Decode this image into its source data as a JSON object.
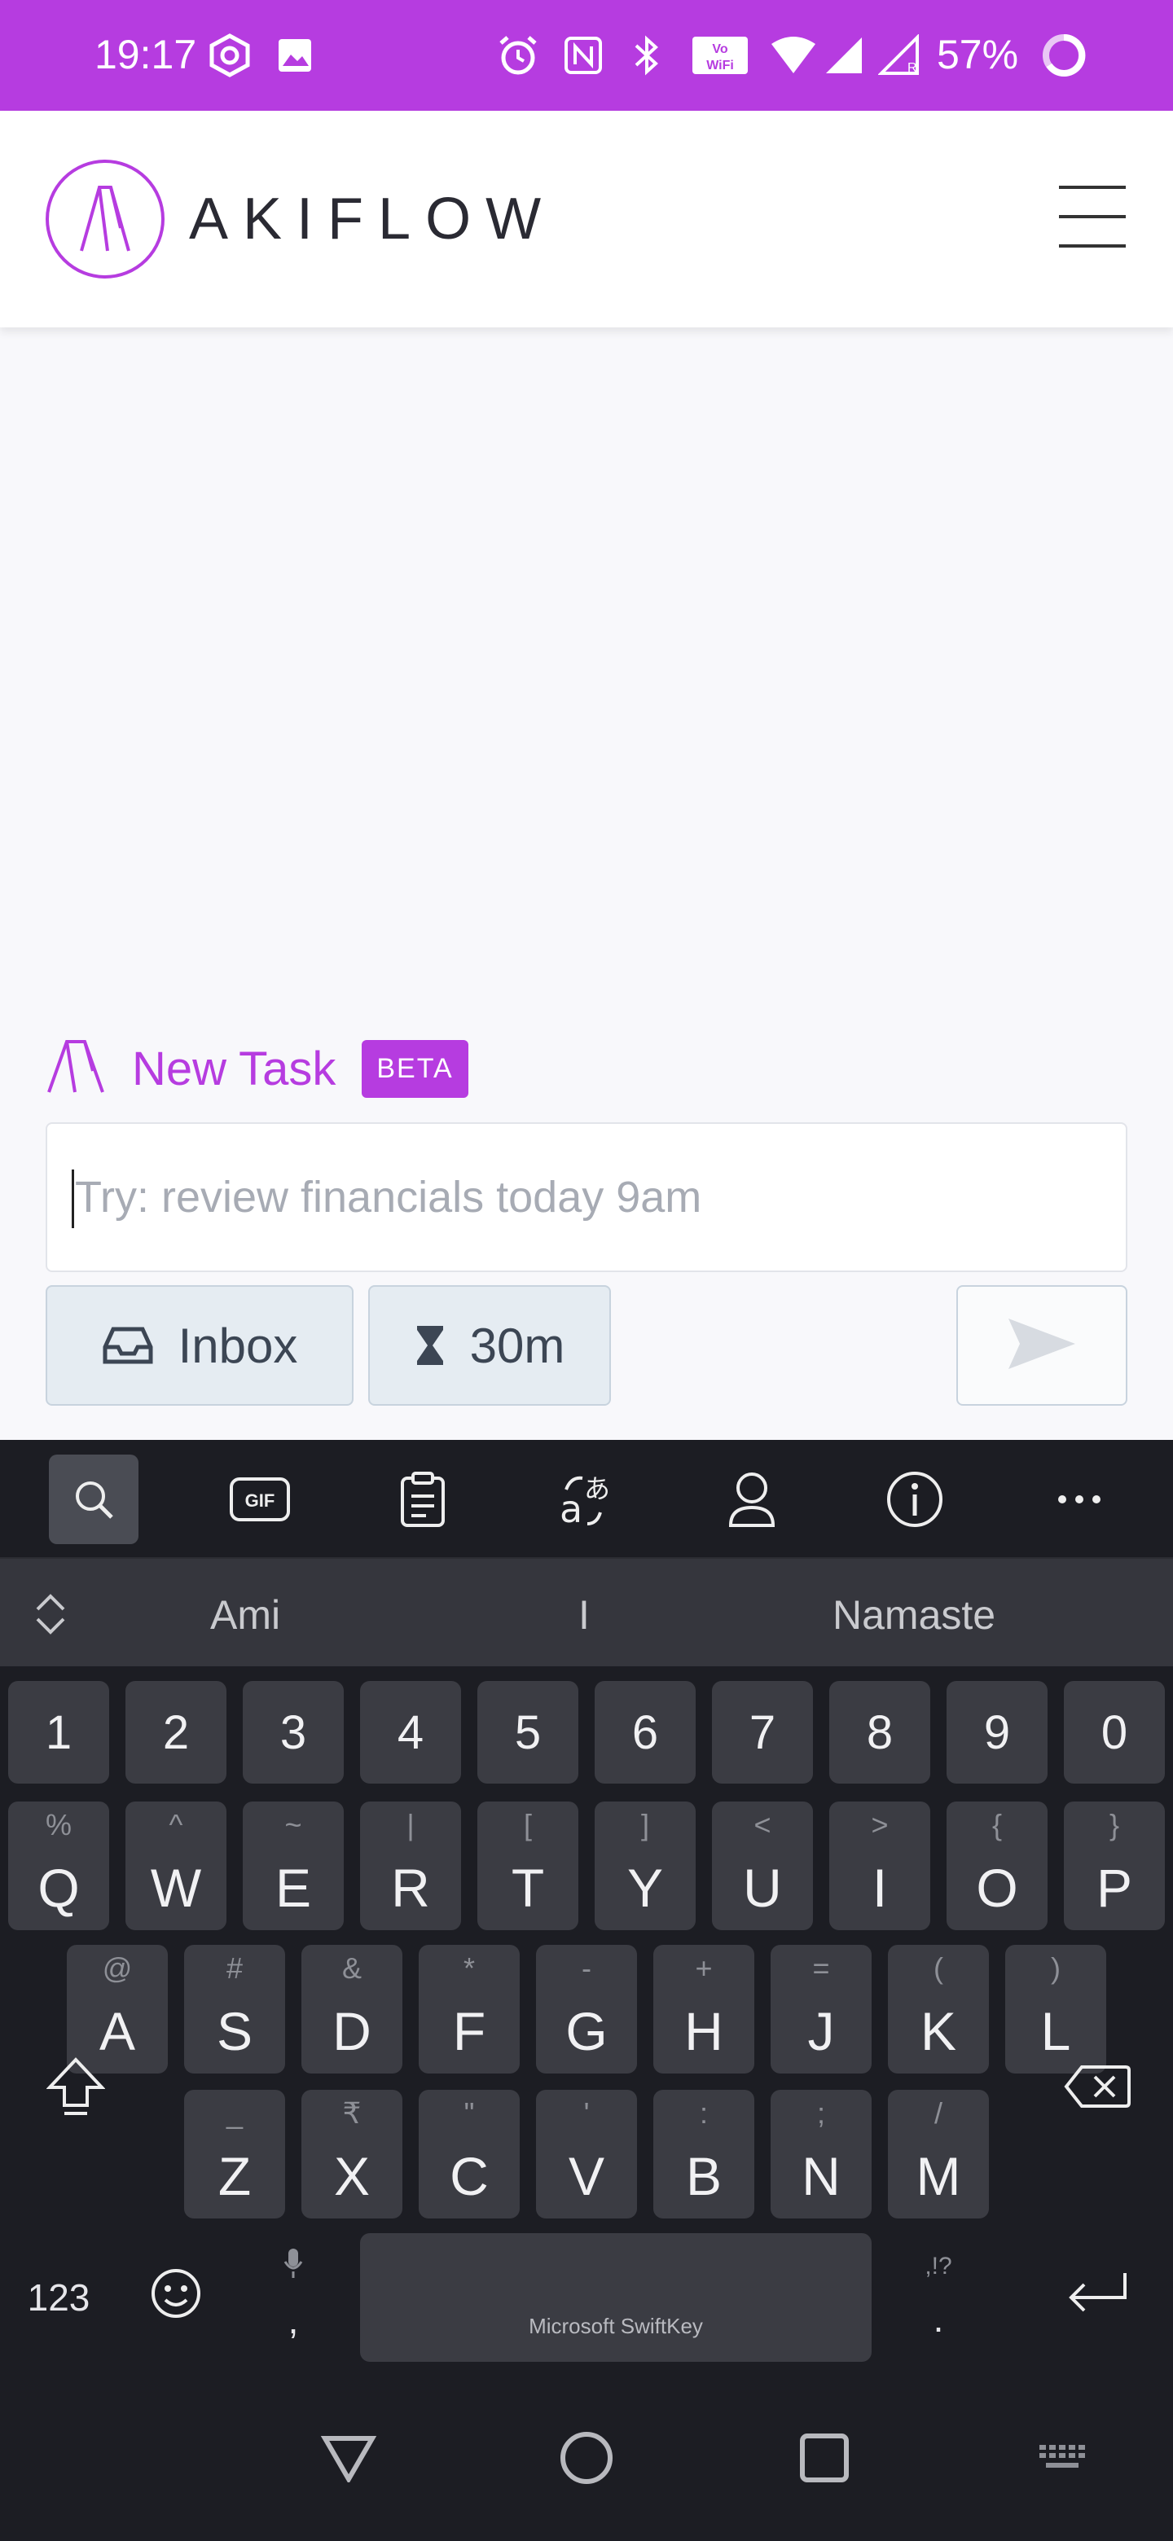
{
  "status_bar": {
    "time": "19:17",
    "battery": "57%"
  },
  "header": {
    "logo_text": "AKIFLOW",
    "menu_icon": "hamburger-menu-icon"
  },
  "new_task": {
    "title": "New Task",
    "badge": "BETA",
    "placeholder": "Try: review financials today 9am",
    "inbox_label": "Inbox",
    "duration_label": "30m"
  },
  "keyboard": {
    "suggestions": [
      "Ami",
      "I",
      "Namaste"
    ],
    "number_row": [
      "1",
      "2",
      "3",
      "4",
      "5",
      "6",
      "7",
      "8",
      "9",
      "0"
    ],
    "row1": [
      {
        "k": "Q",
        "a": "%"
      },
      {
        "k": "W",
        "a": "^"
      },
      {
        "k": "E",
        "a": "~"
      },
      {
        "k": "R",
        "a": "|"
      },
      {
        "k": "T",
        "a": "["
      },
      {
        "k": "Y",
        "a": "]"
      },
      {
        "k": "U",
        "a": "<"
      },
      {
        "k": "I",
        "a": ">"
      },
      {
        "k": "O",
        "a": "{"
      },
      {
        "k": "P",
        "a": "}"
      }
    ],
    "row2": [
      {
        "k": "A",
        "a": "@"
      },
      {
        "k": "S",
        "a": "#"
      },
      {
        "k": "D",
        "a": "&"
      },
      {
        "k": "F",
        "a": "*"
      },
      {
        "k": "G",
        "a": "-"
      },
      {
        "k": "H",
        "a": "+"
      },
      {
        "k": "J",
        "a": "="
      },
      {
        "k": "K",
        "a": "("
      },
      {
        "k": "L",
        "a": ")"
      }
    ],
    "row3": [
      {
        "k": "Z",
        "a": "_"
      },
      {
        "k": "X",
        "a": "₹"
      },
      {
        "k": "C",
        "a": "\""
      },
      {
        "k": "V",
        "a": "'"
      },
      {
        "k": "B",
        "a": ":"
      },
      {
        "k": "N",
        "a": ";"
      },
      {
        "k": "M",
        "a": "/"
      }
    ],
    "numbers_toggle": "123",
    "comma": ",",
    "period": ".",
    "period_alt": ",!?",
    "space_label": "Microsoft SwiftKey"
  },
  "colors": {
    "accent": "#b63ce0",
    "keyboard_bg": "#1c1d23",
    "key_bg": "#3b3c43"
  }
}
